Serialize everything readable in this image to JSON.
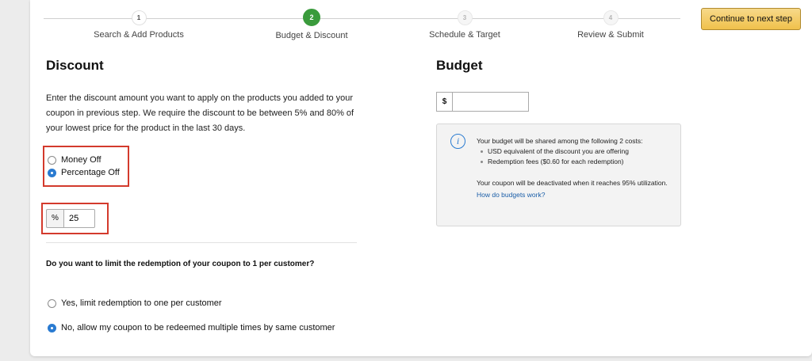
{
  "stepper": {
    "steps": [
      {
        "number": "1",
        "label": "Search & Add Products",
        "state": "done"
      },
      {
        "number": "2",
        "label": "Budget & Discount",
        "state": "active"
      },
      {
        "number": "3",
        "label": "Schedule & Target",
        "state": "future"
      },
      {
        "number": "4",
        "label": "Review & Submit",
        "state": "future"
      }
    ],
    "continue_label": "Continue to next step"
  },
  "discount": {
    "title": "Discount",
    "description": "Enter the discount amount you want to apply on the products you added to your coupon in previous step. We require the discount to be between 5% and 80% of your lowest price for the product in the last 30 days.",
    "options": [
      {
        "label": "Money Off",
        "checked": false
      },
      {
        "label": "Percentage Off",
        "checked": true
      }
    ],
    "amount_addon": "%",
    "amount_value": "25"
  },
  "limit": {
    "question": "Do you want to limit the redemption of your coupon to 1 per customer?",
    "options": [
      {
        "label": "Yes, limit redemption to one per customer",
        "checked": false
      },
      {
        "label": "No, allow my coupon to be redeemed multiple times by same customer",
        "checked": true
      }
    ]
  },
  "budget": {
    "title": "Budget",
    "currency_addon": "$",
    "value": "",
    "info": {
      "intro": "Your budget will be shared among the following 2 costs:",
      "bullets": [
        "USD equivalent of the discount you are offering",
        "Redemption fees ($0.60 for each redemption)"
      ],
      "deactivation": "Your coupon will be deactivated when it reaches 95% utilization.",
      "link": "How do budgets work?"
    }
  },
  "colors": {
    "accent_blue": "#2a7bd1",
    "step_active_green": "#3a9b3c",
    "highlight_red": "#d33a2c",
    "button_yellow": "#f0c14b"
  }
}
